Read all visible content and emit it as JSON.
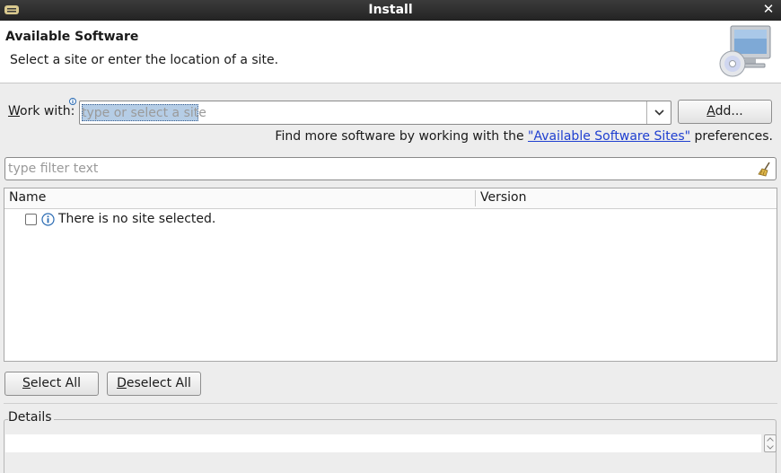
{
  "window": {
    "title": "Install",
    "menu_icon": "window-menu-icon",
    "close_label": "✕"
  },
  "header": {
    "title": "Available Software",
    "description": "Select a site or enter the location of a site.",
    "icon": "computer-cd-icon"
  },
  "work_with": {
    "label_accel": "W",
    "label_rest": "ork with:",
    "placeholder": "type or select a site",
    "value": "",
    "add_button": {
      "accel": "A",
      "rest": "dd..."
    }
  },
  "find_more": {
    "prefix": "Find more software by working with the ",
    "link": "\"Available Software Sites\"",
    "suffix": " preferences."
  },
  "filter": {
    "placeholder": "type filter text",
    "clear_icon": "clear-filter-broom-icon"
  },
  "table": {
    "columns": [
      "Name",
      "Version"
    ],
    "rows": [
      {
        "checked": false,
        "icon": "info-icon",
        "name": "There is no site selected.",
        "version": ""
      }
    ]
  },
  "buttons": {
    "select_all": {
      "accel": "S",
      "rest": "elect All"
    },
    "deselect_all": {
      "accel": "D",
      "rest": "eselect All"
    }
  },
  "details": {
    "label": "Details",
    "text": ""
  },
  "colors": {
    "link": "#1f3fd0",
    "titlebar": "#2c2c2c",
    "selection": "#b5cde6"
  }
}
